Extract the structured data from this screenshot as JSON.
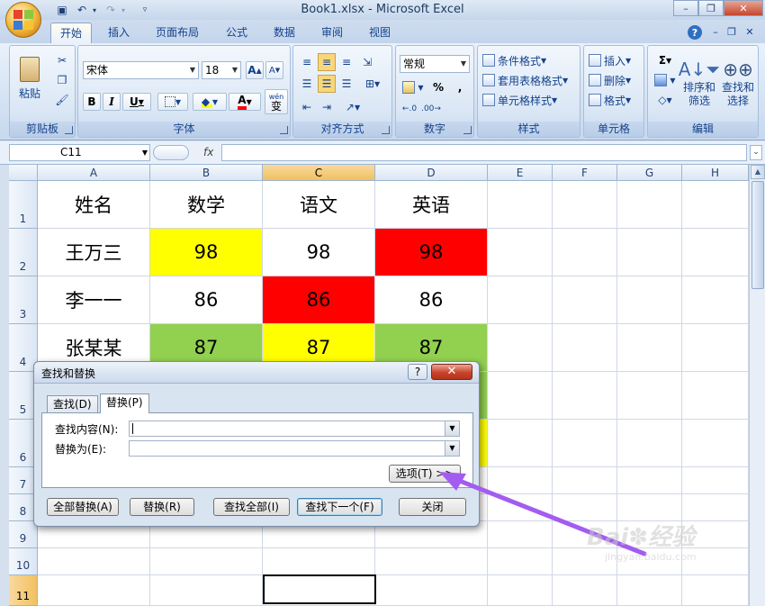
{
  "title": "Book1.xlsx - Microsoft Excel",
  "ribbon_tabs": [
    "开始",
    "插入",
    "页面布局",
    "公式",
    "数据",
    "审阅",
    "视图"
  ],
  "ribbon": {
    "clipboard": {
      "paste": "粘贴",
      "label": "剪贴板"
    },
    "font": {
      "name": "宋体",
      "size": "18",
      "bold": "B",
      "italic": "I",
      "underline": "U",
      "font_color": "A",
      "wen": "wén",
      "wen_sub": "变",
      "label": "字体"
    },
    "alignment": {
      "label": "对齐方式"
    },
    "number": {
      "format": "常规",
      "percent": "%",
      "comma": ",",
      "label": "数字"
    },
    "styles": {
      "conditional": "条件格式",
      "table": "套用表格格式",
      "cell": "单元格样式",
      "label": "样式"
    },
    "cells": {
      "insert": "插入",
      "delete": "删除",
      "format": "格式",
      "label": "单元格"
    },
    "editing": {
      "sigma": "Σ",
      "sort": "排序和",
      "sort2": "筛选",
      "find": "查找和",
      "find2": "选择",
      "label": "编辑"
    }
  },
  "formula_bar": {
    "name_box": "C11",
    "fx": "fx",
    "value": ""
  },
  "columns": [
    "A",
    "B",
    "C",
    "D",
    "E",
    "F",
    "G",
    "H"
  ],
  "rows": [
    "1",
    "2",
    "3",
    "4",
    "5",
    "6",
    "7",
    "8",
    "9",
    "10",
    "11"
  ],
  "table": [
    [
      "姓名",
      "数学",
      "语文",
      "英语"
    ],
    [
      "王万三",
      "98",
      "98",
      "98"
    ],
    [
      "李一一",
      "86",
      "86",
      "86"
    ],
    [
      "张某某",
      "87",
      "87",
      "87"
    ]
  ],
  "cell_colors": {
    "yellow": "#ffff00",
    "red": "#ff0000",
    "green": "#92d050"
  },
  "dialog": {
    "title": "查找和替换",
    "help": "?",
    "close": "✕",
    "tab_find": "查找(D)",
    "tab_replace": "替换(P)",
    "find_label": "查找内容(N):",
    "replace_label": "替换为(E):",
    "options": "选项(T) >>",
    "replace_all": "全部替换(A)",
    "replace": "替换(R)",
    "find_all": "查找全部(I)",
    "find_next": "查找下一个(F)",
    "close_btn": "关闭"
  },
  "watermark": {
    "brand": "Bai",
    "brand2": "经验",
    "url": "jingyan.baidu.com"
  }
}
